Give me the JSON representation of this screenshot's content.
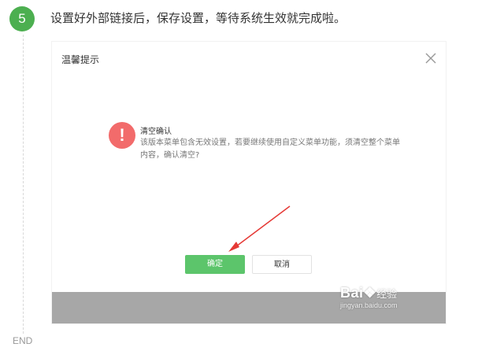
{
  "step": {
    "number": "5",
    "text": "设置好外部链接后，保存设置，等待系统生效就完成啦。"
  },
  "timeline": {
    "end_label": "END"
  },
  "dialog": {
    "title": "温馨提示",
    "message_title": "清空确认",
    "message_body": "该版本菜单包含无效设置，若要继续使用自定义菜单功能，须清空整个菜单内容，确认清空?",
    "confirm_label": "确定",
    "cancel_label": "取消"
  },
  "watermark": {
    "brand": "Bai",
    "suffix": "经验",
    "url": "jingyan.baidu.com"
  },
  "colors": {
    "accent": "#5cc56b",
    "step_badge": "#4caf50",
    "warning": "#f26b6b",
    "arrow": "#e53935"
  }
}
